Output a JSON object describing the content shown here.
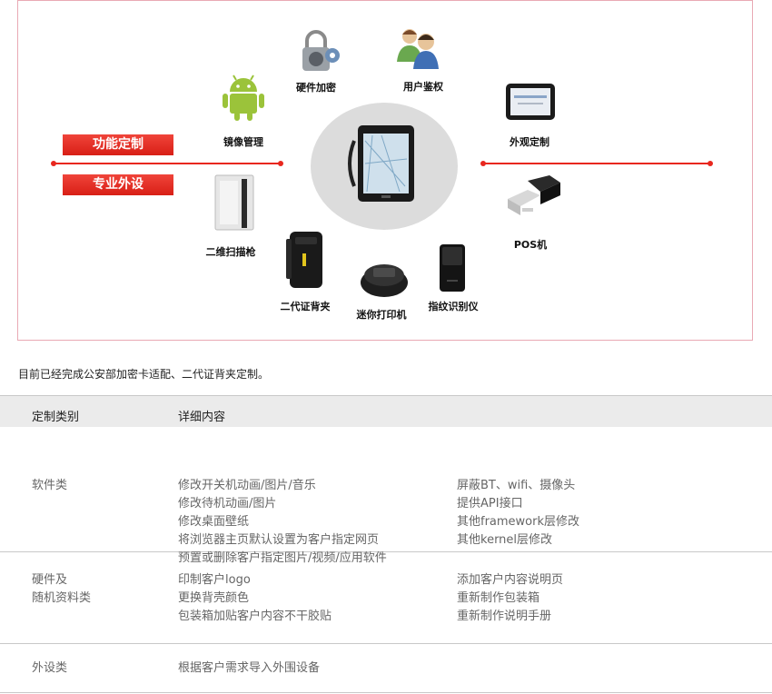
{
  "diagram": {
    "left_button": "功能定制",
    "right_button": "专业外设",
    "items": {
      "mirror": "镜像管理",
      "encrypt": "硬件加密",
      "auth": "用户鉴权",
      "appearance": "外观定制",
      "pos": "POS机",
      "fingerprint": "指纹识别仪",
      "printer": "迷你打印机",
      "idcard": "二代证背夹",
      "scanner": "二维扫描枪"
    },
    "colors": {
      "accent": "#e8271e",
      "border": "#e9a9b4",
      "android": "#9bc33a"
    }
  },
  "caption": "目前已经完成公安部加密卡适配、二代证背夹定制。",
  "table": {
    "headers": [
      "定制类别",
      "详细内容"
    ],
    "rows": [
      {
        "category": [
          "软件类"
        ],
        "col_a": [
          "修改开关机动画/图片/音乐",
          "修改待机动画/图片",
          "修改桌面壁纸",
          "将浏览器主页默认设置为客户指定网页",
          "预置或删除客户指定图片/视频/应用软件"
        ],
        "col_b": [
          "屏蔽BT、wifi、摄像头",
          "提供API接口",
          "其他framework层修改",
          "其他kernel层修改"
        ]
      },
      {
        "category": [
          "硬件及",
          "随机资料类"
        ],
        "col_a": [
          "印制客户logo",
          "更换背壳颜色",
          "包装箱加贴客户内容不干胶贴"
        ],
        "col_b": [
          "添加客户内容说明页",
          "重新制作包装箱",
          "重新制作说明手册"
        ]
      },
      {
        "category": [
          "外设类"
        ],
        "col_a": [
          "根据客户需求导入外围设备"
        ],
        "col_b": []
      }
    ]
  }
}
